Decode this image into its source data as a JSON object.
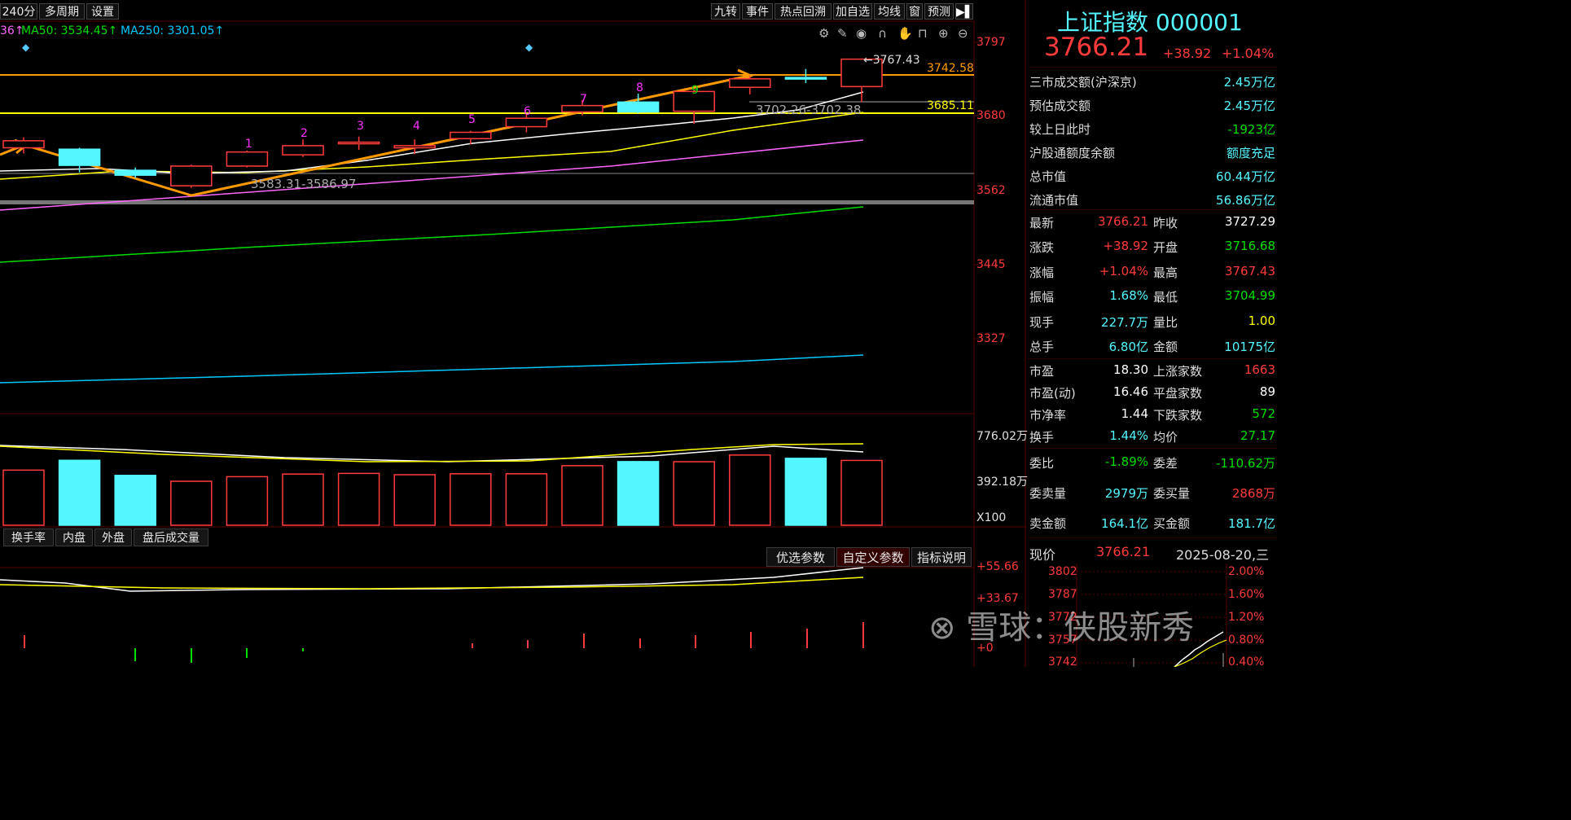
{
  "toolbar": {
    "period": "240分",
    "multi_period": "多周期",
    "settings": "设置"
  },
  "right_toolbar": [
    "九转",
    "事件",
    "热点回溯",
    "加自选",
    "均线",
    "窗",
    "预测"
  ],
  "ma_labels": {
    "ma_prefix": "36↑",
    "ma50": "MA50: 3534.45↑",
    "ma250": "MA250: 3301.05↑"
  },
  "colors": {
    "up": "#ff3b3b",
    "down": "#54f7ff",
    "ma5": "#ffffff",
    "ma10": "#ffff00",
    "ma20": "#ff66ff",
    "ma60": "#00dd00",
    "ma250": "#00c8ff",
    "trend": "#ff9900",
    "bg": "#000000"
  },
  "price_axis": {
    "ticks": [
      "3797",
      "3680",
      "3562",
      "3445",
      "3327"
    ],
    "ymin": 3262,
    "ymax": 3820
  },
  "volume_axis": {
    "ticks": [
      "776.02万",
      "392.18万"
    ],
    "unit": "X100"
  },
  "indicator_axis": {
    "ticks": [
      "+55.66",
      "+33.67",
      "+0"
    ]
  },
  "annotations": {
    "high_label": "3767.43",
    "level_1": "3742.58",
    "level_2": "3685.11",
    "range_1": "3583.31-3586.97",
    "range_2": "3702.26-3702.38"
  },
  "nine_turn_counts": [
    "1",
    "2",
    "3",
    "4",
    "5",
    "6",
    "7",
    "8",
    "9"
  ],
  "chart_data": {
    "type": "candlestick",
    "candles": [
      {
        "open": 3640,
        "close": 3650,
        "high": 3655,
        "low": 3632
      },
      {
        "open": 3638,
        "close": 3615,
        "high": 3640,
        "low": 3605
      },
      {
        "open": 3608,
        "close": 3601,
        "high": 3612,
        "low": 3597
      },
      {
        "open": 3586,
        "close": 3614,
        "high": 3616,
        "low": 3583
      },
      {
        "open": 3614,
        "close": 3634,
        "high": 3636,
        "low": 3612
      },
      {
        "open": 3630,
        "close": 3643,
        "high": 3652,
        "low": 3627
      },
      {
        "open": 3646,
        "close": 3648,
        "high": 3656,
        "low": 3637
      },
      {
        "open": 3640,
        "close": 3643,
        "high": 3652,
        "low": 3631
      },
      {
        "open": 3653,
        "close": 3662,
        "high": 3664,
        "low": 3645
      },
      {
        "open": 3670,
        "close": 3682,
        "high": 3688,
        "low": 3662
      },
      {
        "open": 3691,
        "close": 3700,
        "high": 3708,
        "low": 3686
      },
      {
        "open": 3705,
        "close": 3691,
        "high": 3717,
        "low": 3689
      },
      {
        "open": 3692,
        "close": 3720,
        "high": 3722,
        "low": 3674
      },
      {
        "open": 3726,
        "close": 3738,
        "high": 3742,
        "low": 3716
      },
      {
        "open": 3740,
        "close": 3739,
        "high": 3752,
        "low": 3732
      },
      {
        "open": 3727,
        "close": 3766,
        "high": 3767,
        "low": 3705
      }
    ],
    "volume": [
      420,
      495,
      380,
      335,
      370,
      390,
      395,
      385,
      392,
      392,
      454,
      485,
      484,
      535,
      510,
      494
    ],
    "volume_ymax": 776.02
  },
  "quote": {
    "name": "上证指数",
    "code": "000001",
    "price": "3766.21",
    "change": "+38.92",
    "pct": "+1.04%",
    "rows1": [
      {
        "label": "三市成交额(沪深京)",
        "value": "2.45万亿",
        "color": "#54f7ff"
      },
      {
        "label": "预估成交额",
        "value": "2.45万亿",
        "color": "#54f7ff"
      },
      {
        "label": "较上日此时",
        "value": "-1923亿",
        "color": "#00dd00"
      },
      {
        "label": "沪股通额度余额",
        "value": "额度充足",
        "color": "#54f7ff"
      },
      {
        "label": "总市值",
        "value": "60.44万亿",
        "color": "#54f7ff"
      },
      {
        "label": "流通市值",
        "value": "56.86万亿",
        "color": "#54f7ff"
      }
    ],
    "rows2": [
      {
        "l1": "最新",
        "v1": "3766.21",
        "c1": "#ff3b3b",
        "l2": "昨收",
        "v2": "3727.29",
        "c2": "#ffffff"
      },
      {
        "l1": "涨跌",
        "v1": "+38.92",
        "c1": "#ff3b3b",
        "l2": "开盘",
        "v2": "3716.68",
        "c2": "#00dd00"
      },
      {
        "l1": "涨幅",
        "v1": "+1.04%",
        "c1": "#ff3b3b",
        "l2": "最高",
        "v2": "3767.43",
        "c2": "#ff3b3b"
      },
      {
        "l1": "振幅",
        "v1": "1.68%",
        "c1": "#54f7ff",
        "l2": "最低",
        "v2": "3704.99",
        "c2": "#00dd00"
      },
      {
        "l1": "现手",
        "v1": "227.7万",
        "c1": "#54f7ff",
        "l2": "量比",
        "v2": "1.00",
        "c2": "#ffff00"
      },
      {
        "l1": "总手",
        "v1": "6.80亿",
        "c1": "#54f7ff",
        "l2": "金额",
        "v2": "10175亿",
        "c2": "#54f7ff"
      }
    ],
    "rows3": [
      {
        "l1": "市盈",
        "v1": "18.30",
        "c1": "#ffffff",
        "l2": "上涨家数",
        "v2": "1663",
        "c2": "#ff3b3b"
      },
      {
        "l1": "市盈(动)",
        "v1": "16.46",
        "c1": "#ffffff",
        "l2": "平盘家数",
        "v2": "89",
        "c2": "#ffffff"
      },
      {
        "l1": "市净率",
        "v1": "1.44",
        "c1": "#ffffff",
        "l2": "下跌家数",
        "v2": "572",
        "c2": "#00dd00"
      },
      {
        "l1": "换手",
        "v1": "1.44%",
        "c1": "#54f7ff",
        "l2": "均价",
        "v2": "27.17",
        "c2": "#00dd00"
      }
    ],
    "rows4": [
      {
        "l1": "委比",
        "v1": "-1.89%",
        "c1": "#00dd00",
        "l2": "委差",
        "v2": "-110.62万",
        "c2": "#00dd00"
      },
      {
        "l1": "委卖量",
        "v1": "2979万",
        "c1": "#54f7ff",
        "l2": "委买量",
        "v2": "2868万",
        "c2": "#ff3b3b"
      },
      {
        "l1": "卖金额",
        "v1": "164.1亿",
        "c1": "#54f7ff",
        "l2": "买金额",
        "v2": "181.7亿",
        "c2": "#54f7ff"
      }
    ],
    "mini": {
      "label": "现价",
      "price": "3766.21",
      "date": "2025-08-20,三",
      "left_ticks": [
        "3802",
        "3787",
        "3772",
        "3757",
        "3742"
      ],
      "right_ticks": [
        "2.00%",
        "1.60%",
        "1.20%",
        "0.80%",
        "0.40%"
      ]
    }
  },
  "vol_tabs": [
    "换手率",
    "内盘",
    "外盘",
    "盘后成交量"
  ],
  "param_tabs": [
    "优选参数",
    "自定义参数",
    "指标说明"
  ],
  "watermark": "雪球：侠股新秀"
}
